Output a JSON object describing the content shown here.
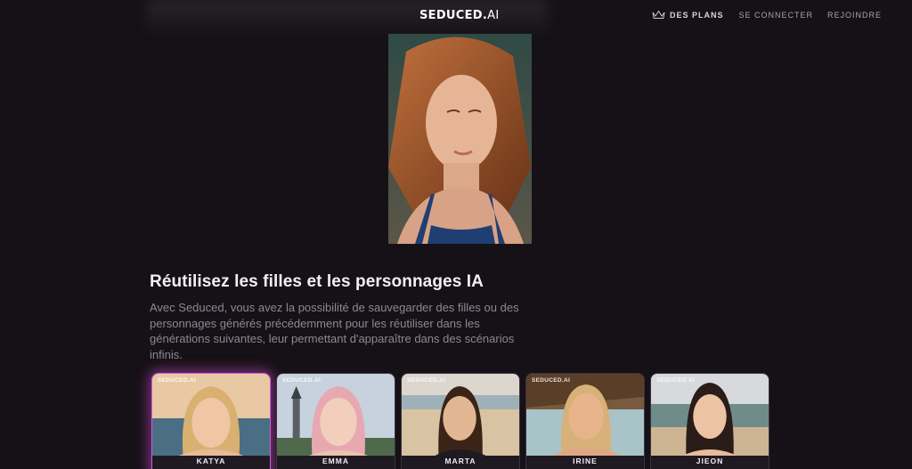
{
  "header": {
    "logo_main": "SEDUCED.",
    "logo_suffix": "AI",
    "nav": {
      "plans": "DES PLANS",
      "login": "SE CONNECTER",
      "join": "REJOINDRE"
    },
    "icons": {
      "plans": "crown-icon"
    }
  },
  "hero": {
    "image": "portrait-woman-auburn-hair-blue-top"
  },
  "section": {
    "title": "Réutilisez les filles et les personnages IA",
    "text": "Avec Seduced, vous avez la possibilité de sauvegarder des filles ou des personnages générés précédemment pour les réutiliser dans les générations suivantes, leur permettant d'apparaître dans des scénarios infinis."
  },
  "cards": [
    {
      "name": "KATYA",
      "watermark": "SEDUCED.AI",
      "active": true
    },
    {
      "name": "EMMA",
      "watermark": "SEDUCED.AI",
      "active": false
    },
    {
      "name": "MARTA",
      "watermark": "SEDUCED.AI",
      "active": false
    },
    {
      "name": "IRINE",
      "watermark": "SEDUCED.AI",
      "active": false
    },
    {
      "name": "JIEON",
      "watermark": "SEDUCED.AI",
      "active": false
    }
  ],
  "colors": {
    "background": "#161116",
    "accent": "#d65ad8",
    "text_muted": "#8e8794"
  }
}
